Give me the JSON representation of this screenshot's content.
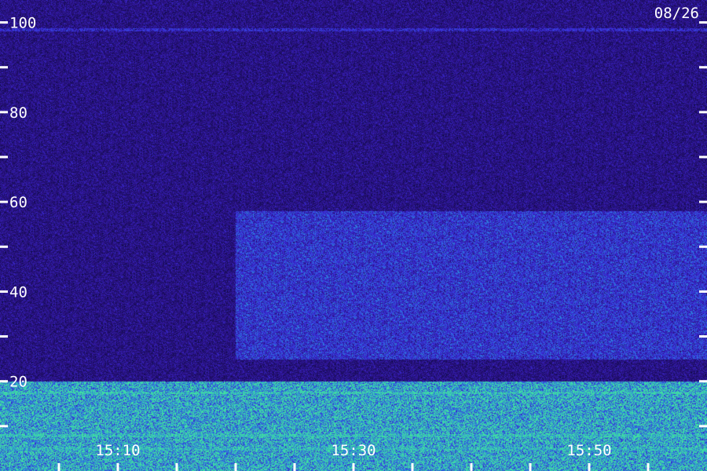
{
  "chart_data": {
    "type": "heatmap",
    "title": "",
    "xlabel": "",
    "ylabel": "",
    "date_label": "08/26",
    "y_ticks": [
      100,
      80,
      60,
      40,
      20
    ],
    "y_minor_ticks": [
      90,
      70,
      50,
      30,
      10
    ],
    "ylim": [
      0,
      105
    ],
    "x_tick_labels": [
      "15:10",
      "15:30",
      "15:50"
    ],
    "x_tick_times_min": [
      10,
      30,
      50
    ],
    "x_minor_tick_times_min": [
      5,
      10,
      15,
      20,
      25,
      30,
      35,
      40,
      45,
      50,
      55
    ],
    "xlim_min": [
      0,
      60
    ],
    "grid": false,
    "colormap": [
      "#0a0a3c",
      "#2a1080",
      "#3a2ad8",
      "#2a80e0",
      "#40e0a0"
    ],
    "regions": [
      {
        "t_start_min": 0,
        "t_end_min": 60,
        "y_low": 0,
        "y_high": 20,
        "level": 0.85
      },
      {
        "t_start_min": 20,
        "t_end_min": 60,
        "y_low": 25,
        "y_high": 58,
        "level": 0.5
      },
      {
        "t_start_min": 0,
        "t_end_min": 60,
        "y_low": 20,
        "y_high": 105,
        "level": 0.25
      }
    ],
    "lines": [
      {
        "y": 98.5,
        "level": 0.55
      },
      {
        "y": 17.5,
        "level": 0.95
      },
      {
        "y": 8,
        "level": 0.9
      },
      {
        "y": 5,
        "level": 0.85
      }
    ]
  }
}
